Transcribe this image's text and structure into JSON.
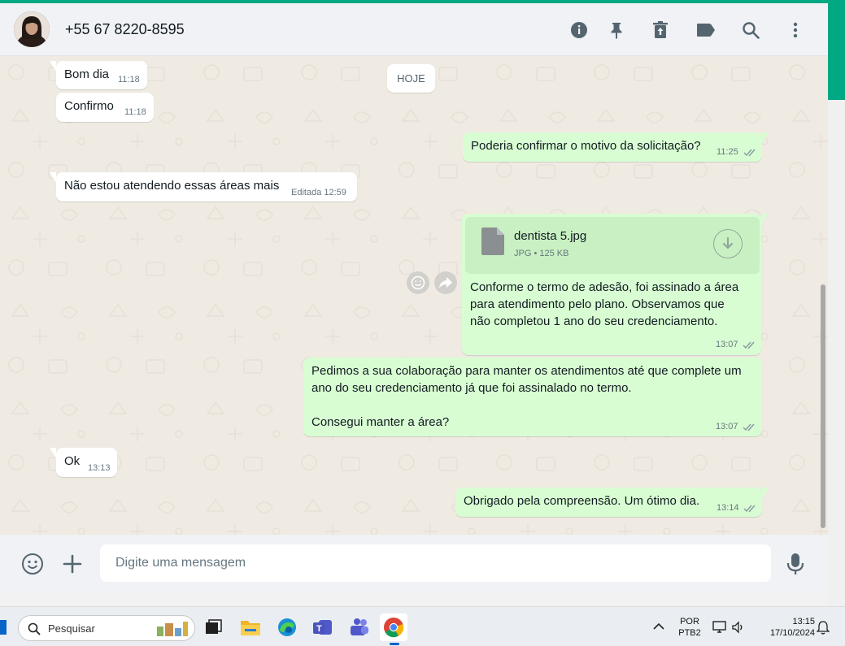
{
  "header": {
    "contact_name": "+55 67 8220-8595",
    "icons": [
      "info-icon",
      "pin-icon",
      "delete-icon",
      "label-icon",
      "search-icon",
      "menu-icon"
    ]
  },
  "chat": {
    "date_chip": "HOJE",
    "messages": [
      {
        "dir": "in",
        "text": "Bom dia",
        "time": "11:18"
      },
      {
        "dir": "in",
        "text": "Confirmo",
        "time": "11:18"
      },
      {
        "dir": "out",
        "text": "Poderia confirmar o motivo da solicitação?",
        "time": "11:25",
        "status": "read"
      },
      {
        "dir": "in",
        "text": "Não estou atendendo essas áreas mais",
        "edited": "Editada",
        "time": "12:59"
      },
      {
        "dir": "out",
        "type": "file",
        "file_name": "dentista 5.jpg",
        "file_type": "JPG",
        "file_size": "125 KB",
        "lines": [
          "Conforme o termo de adesão, foi assinado a área",
          "para atendimento pelo plano. Observamos que",
          "não completou 1 ano do seu credenciamento."
        ],
        "time": "13:07",
        "status": "read"
      },
      {
        "dir": "out",
        "lines": [
          "Pedimos a sua colaboração para manter os atendimentos até que complete um",
          "ano do seu credenciamento já que foi assinalado no termo.",
          "",
          "Consegui manter a área?"
        ],
        "time": "13:07",
        "status": "read"
      },
      {
        "dir": "in",
        "text": "Ok",
        "time": "13:13"
      },
      {
        "dir": "out",
        "text": "Obrigado pela compreensão. Um ótimo dia.",
        "time": "13:14",
        "status": "read"
      }
    ]
  },
  "footer": {
    "placeholder": "Digite uma mensagem"
  },
  "taskbar": {
    "search_label": "Pesquisar",
    "lang_top": "POR",
    "lang_bottom": "PTB2",
    "clock_time": "13:15",
    "clock_date": "17/10/2024"
  },
  "colors": {
    "accent": "#00a884",
    "outgoing_bubble": "#d9fdd3",
    "incoming_bubble": "#ffffff",
    "chat_bg": "#efeae2",
    "read_ticks": "#8696a0"
  }
}
